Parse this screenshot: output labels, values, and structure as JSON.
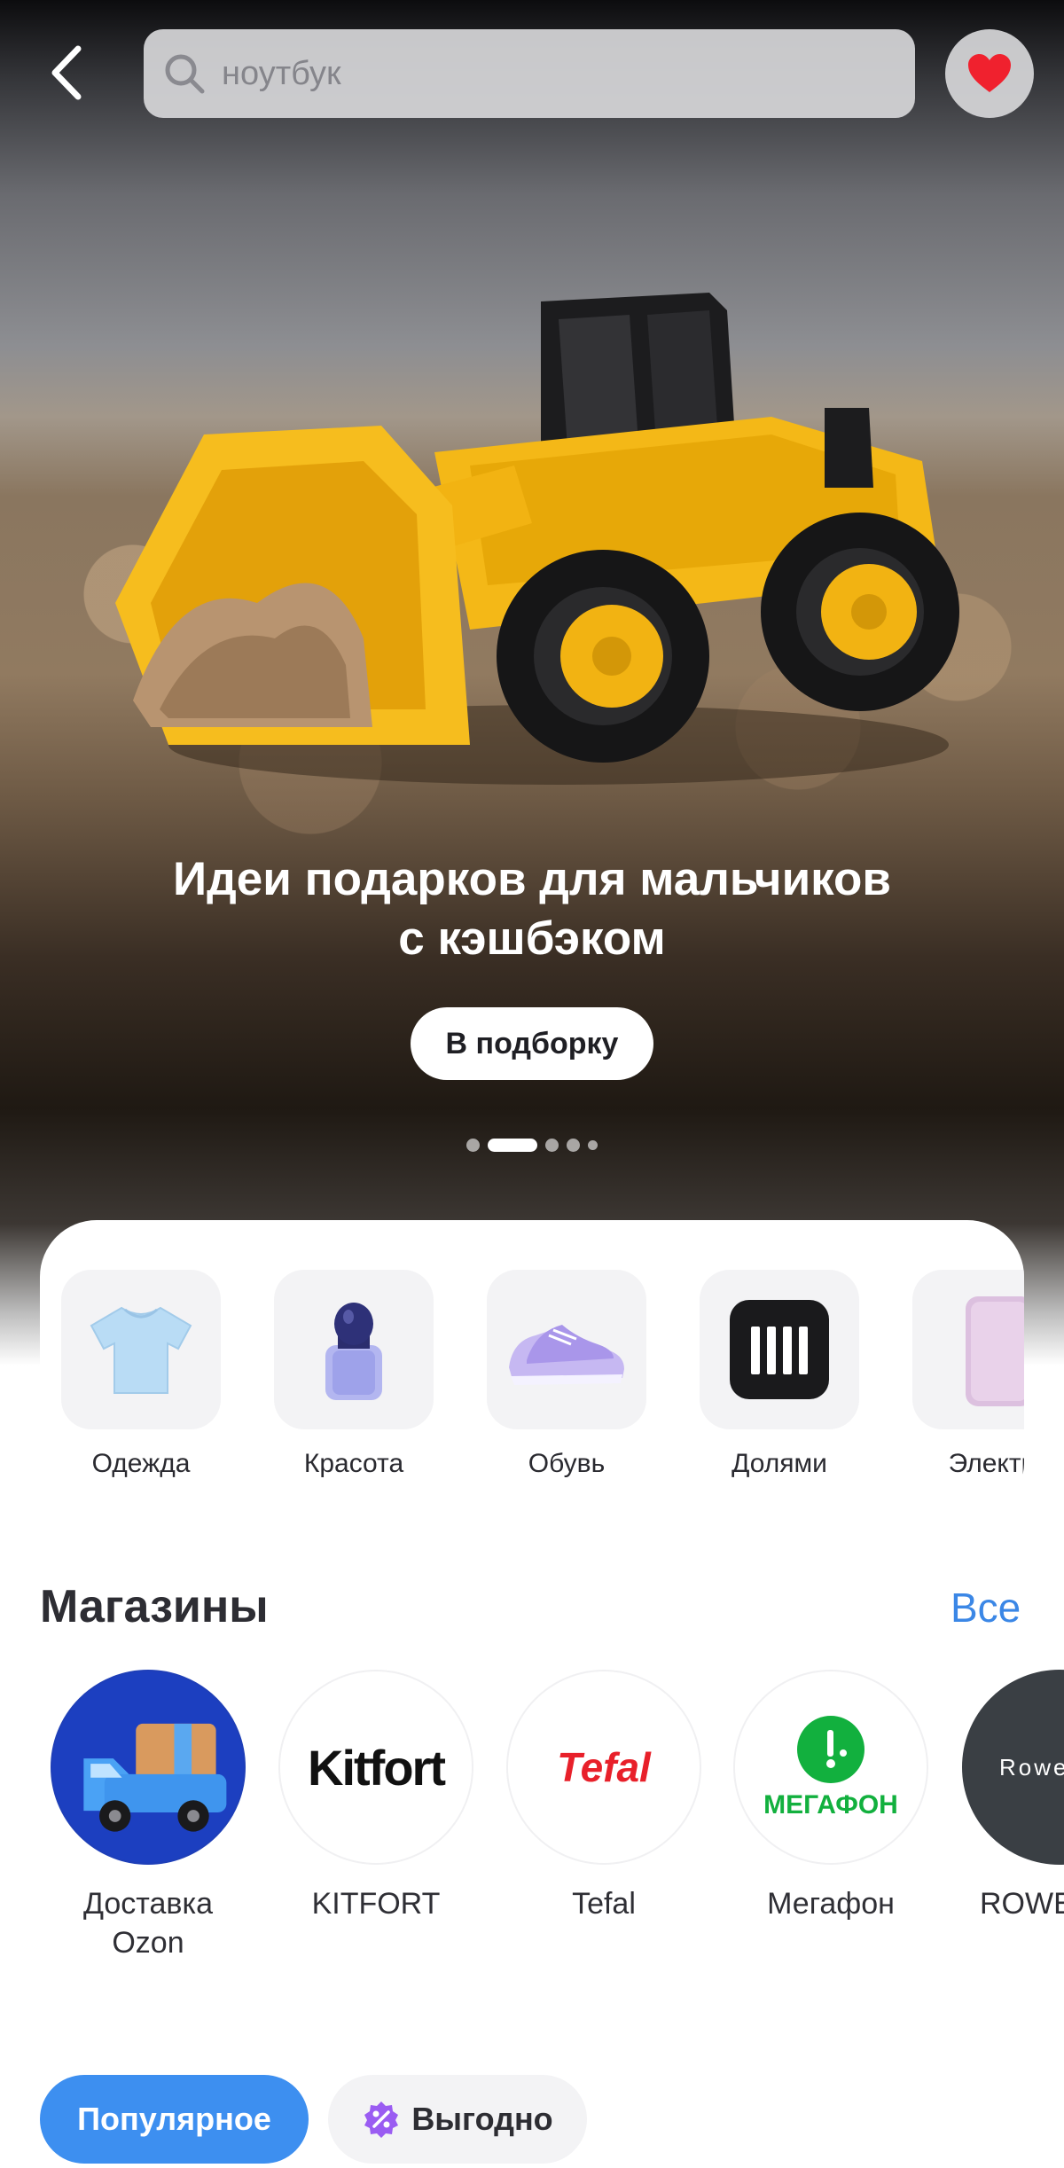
{
  "search": {
    "placeholder": "ноутбук"
  },
  "banner": {
    "title_line1": "Идеи подарков для мальчиков",
    "title_line2": "с кэшбэком",
    "button_label": "В подборку",
    "slides_total": 5,
    "active_slide": 2
  },
  "categories": [
    {
      "label": "Одежда",
      "icon": "tshirt-icon"
    },
    {
      "label": "Красота",
      "icon": "perfume-bottle-icon"
    },
    {
      "label": "Обувь",
      "icon": "sneakers-icon"
    },
    {
      "label": "Долями",
      "icon": "dolyami-logo-icon"
    },
    {
      "label": "Электр",
      "icon": "phone-icon"
    }
  ],
  "shops": {
    "title": "Магазины",
    "all_label": "Все",
    "items": [
      {
        "name": "Доставка Ozon",
        "logo": "delivery-truck-icon"
      },
      {
        "name": "KITFORT",
        "logo_text": "Kitfort"
      },
      {
        "name": "Tefal",
        "logo_text": "Tefal"
      },
      {
        "name": "Мегафон",
        "logo_text": "МЕГАФОН"
      },
      {
        "name": "ROWE",
        "logo_text": "Rowe"
      }
    ]
  },
  "chips": {
    "popular": "Популярное",
    "deal": "Выгодно"
  },
  "colors": {
    "accent": "#3d8ff0",
    "link": "#3b87e6",
    "heart": "#f0212e",
    "megafon_green": "#12b03e",
    "tefal_red": "#e8202a"
  }
}
